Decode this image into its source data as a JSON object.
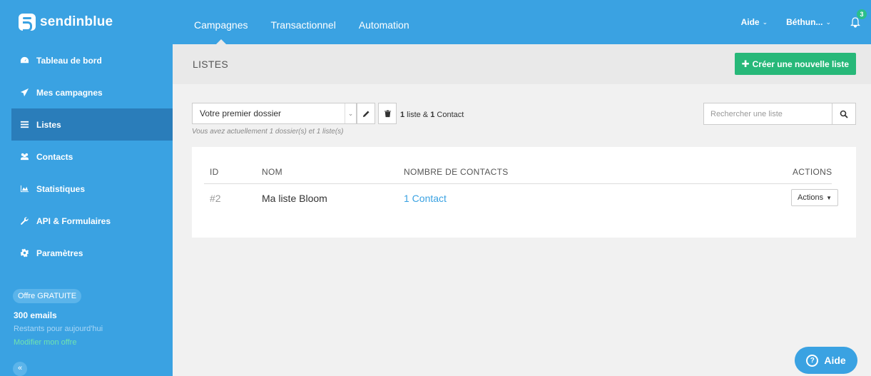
{
  "brand": {
    "name": "sendinblue"
  },
  "topnav": {
    "items": [
      "Campagnes",
      "Transactionnel",
      "Automation"
    ]
  },
  "topright": {
    "help": "Aide",
    "user": "Béthun...",
    "notif_count": "3"
  },
  "sidebar": {
    "items": [
      {
        "label": "Tableau de bord",
        "icon": "dashboard-icon"
      },
      {
        "label": "Mes campagnes",
        "icon": "paper-plane-icon"
      },
      {
        "label": "Listes",
        "icon": "list-icon",
        "active": true
      },
      {
        "label": "Contacts",
        "icon": "users-icon"
      },
      {
        "label": "Statistiques",
        "icon": "area-chart-icon"
      },
      {
        "label": "API & Formulaires",
        "icon": "wrench-icon"
      },
      {
        "label": "Paramètres",
        "icon": "gear-icon"
      }
    ],
    "offer": {
      "badge": "Offre GRATUITE",
      "emails": "300 emails",
      "remaining": "Restants pour aujourd'hui",
      "link": "Modifier mon offre"
    },
    "collapse": "«"
  },
  "page": {
    "title": "LISTES",
    "create_button": "Créer une nouvelle liste",
    "folder": {
      "selected": "Votre premier dossier",
      "help": "Vous avez actuellement 1 dossier(s) et 1 liste(s)"
    },
    "count": {
      "lists_num": "1",
      "lists_word": " liste & ",
      "contacts_num": "1",
      "contacts_word": " Contact"
    },
    "search": {
      "placeholder": "Rechercher une liste"
    },
    "table": {
      "headers": {
        "id": "ID",
        "name": "NOM",
        "contacts": "NOMBRE DE CONTACTS",
        "actions": "ACTIONS"
      },
      "rows": [
        {
          "id": "#2",
          "name": "Ma liste Bloom",
          "contacts": "1 Contact",
          "actions": "Actions"
        }
      ]
    }
  },
  "help_button": {
    "label": "Aide"
  },
  "colors": {
    "primary": "#3aa2e2",
    "active_item": "#2a7dba",
    "success": "#27b879",
    "background": "#f1f1f1"
  }
}
